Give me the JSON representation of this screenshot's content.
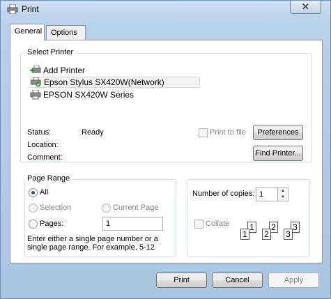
{
  "window": {
    "title": "Print",
    "close_glyph": "✕"
  },
  "tabs": [
    {
      "label": "General",
      "active": true
    },
    {
      "label": "Options",
      "active": false
    }
  ],
  "select_printer": {
    "title": "Select Printer",
    "printers": [
      {
        "label": "Add Printer",
        "icon": "add-printer-icon"
      },
      {
        "label": "Epson Stylus SX420W(Network)",
        "icon": "network-printer-icon",
        "selected": true
      },
      {
        "label": "EPSON SX420W Series",
        "icon": "printer-icon"
      }
    ],
    "status_label": "Status:",
    "status_value": "Ready",
    "location_label": "Location:",
    "comment_label": "Comment:",
    "print_to_file_label": "Print to file",
    "preferences_label": "Preferences",
    "find_printer_label": "Find Printer..."
  },
  "page_range": {
    "title": "Page Range",
    "all_label": "All",
    "selection_label": "Selection",
    "current_page_label": "Current Page",
    "pages_label": "Pages:",
    "pages_value": "1",
    "hint": "Enter either a single page number or a single page range.  For example, 5-12"
  },
  "copies": {
    "label": "Number of copies:",
    "value": "1",
    "collate_label": "Collate"
  },
  "footer": {
    "print_label": "Print",
    "cancel_label": "Cancel",
    "apply_label": "Apply"
  },
  "colors": {
    "accent": "#2a4f86",
    "panel_bg": "#ffffff",
    "frame": "#b9d1ea"
  }
}
